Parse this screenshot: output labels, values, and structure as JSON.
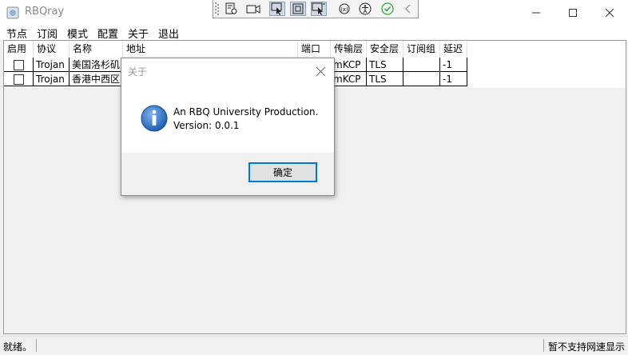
{
  "window": {
    "title": "RBQray"
  },
  "menu": [
    "节点",
    "订阅",
    "模式",
    "配置",
    "关于",
    "退出"
  ],
  "table": {
    "headers": [
      "启用",
      "协议",
      "名称",
      "地址",
      "端口",
      "传输层",
      "安全层",
      "订阅组",
      "延迟"
    ],
    "rows": [
      {
        "enabled": false,
        "protocol": "Trojan",
        "name": "美国洛杉矶",
        "address": "",
        "port": "",
        "transport": "mKCP",
        "security": "TLS",
        "group": "",
        "latency": "-1"
      },
      {
        "enabled": false,
        "protocol": "Trojan",
        "name": "香港中西区",
        "address": "",
        "port": "",
        "transport": "mKCP",
        "security": "TLS",
        "group": "",
        "latency": "-1"
      }
    ]
  },
  "status": {
    "left": "就绪。",
    "right": "暂不支持网速显示"
  },
  "dialog": {
    "title": "关于",
    "line1": "An RBQ University Production.",
    "line2": "Version: 0.0.1",
    "ok_label": "确定"
  },
  "icons": {
    "dialog_info": "info-icon",
    "window_controls": [
      "minimize-icon",
      "maximize-icon",
      "close-icon"
    ]
  },
  "colors": {
    "info_blue": "#1f5fb5",
    "accent": "#0078d7",
    "check_green": "#2eaa3c"
  }
}
